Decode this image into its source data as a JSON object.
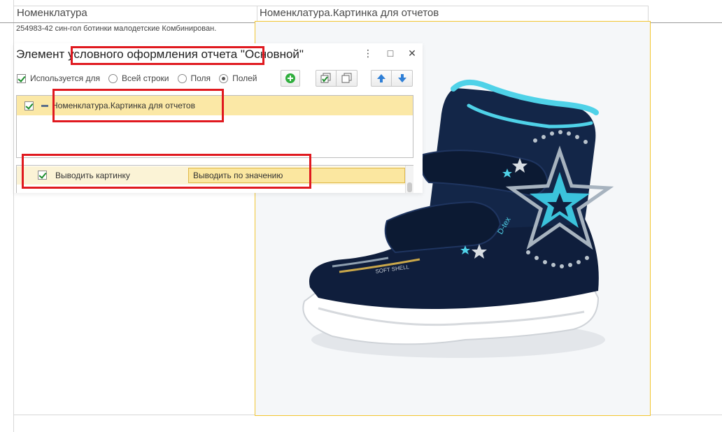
{
  "sheet": {
    "col1_header": "Номенклатура",
    "col2_header": "Номенклатура.Картинка для отчетов",
    "row1_text": "254983-42 син-гол ботинки малодетские Комбинирован."
  },
  "dialog": {
    "title": "Элемент условного оформления отчета \"Основной\"",
    "minimize_glyph": "⋮",
    "restore_glyph": "□",
    "close_glyph": "✕",
    "used_for_label": "Используется для",
    "used_for_checked": true,
    "radio_options": [
      {
        "label": "Всей строки",
        "selected": false
      },
      {
        "label": "Поля",
        "selected": false
      },
      {
        "label": "Полей",
        "selected": true
      }
    ],
    "toolbar": {
      "add_icon": "plus-icon",
      "check_all_icon": "check-all-icon",
      "uncheck_all_icon": "uncheck-all-icon",
      "move_up_icon": "arrow-up-icon",
      "move_down_icon": "arrow-down-icon"
    },
    "fields_list": [
      {
        "checked": true,
        "label": "Номенклатура.Картинка для отчетов"
      }
    ],
    "settings_grid": [
      {
        "checked": true,
        "name": "Выводить картинку",
        "value": "Выводить по значению"
      }
    ]
  },
  "picture": {
    "description_icon": "boot-image",
    "brand_text": "D-tex",
    "logo_text": "SOFT SHELL"
  },
  "colors": {
    "highlight_row": "#fbe8a6",
    "annotation": "#e0191f",
    "frame_border": "#f2c530",
    "check_green": "#1a8c2a"
  }
}
